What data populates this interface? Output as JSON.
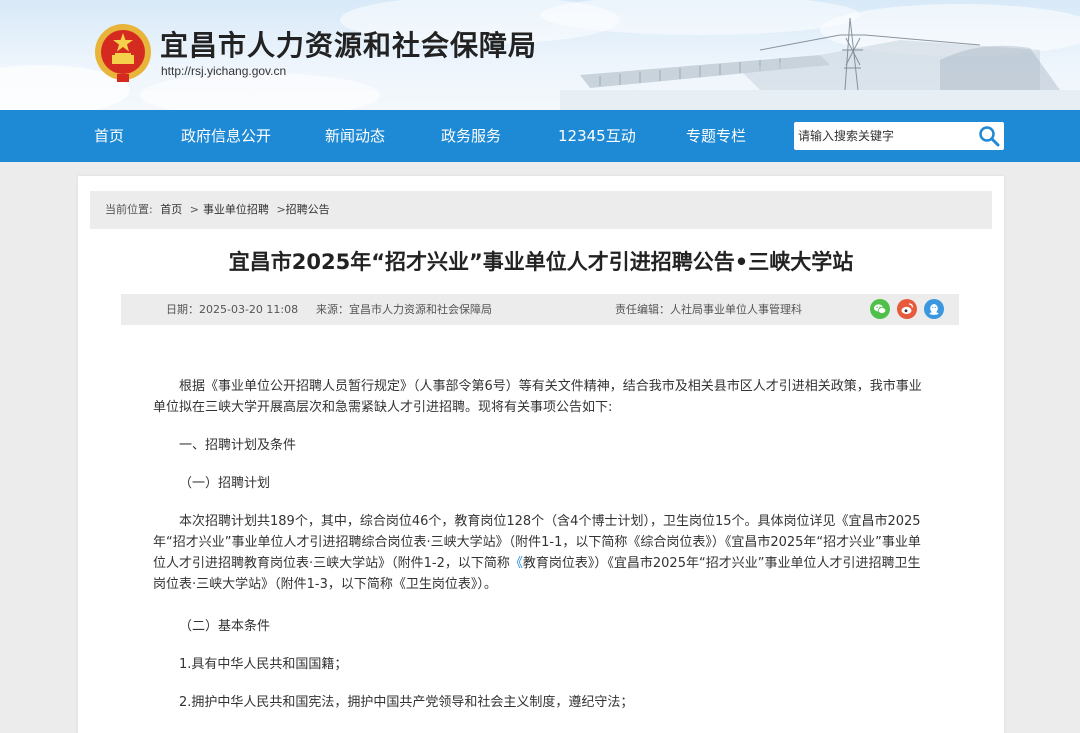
{
  "header": {
    "site_title": "宜昌市人力资源和社会保障局",
    "site_url": "http://rsj.yichang.gov.cn"
  },
  "nav": {
    "items": [
      "首页",
      "政府信息公开",
      "新闻动态",
      "政务服务",
      "12345互动",
      "专题专栏"
    ],
    "search_placeholder": "请输入搜索关键字"
  },
  "breadcrumb": {
    "label": "当前位置:",
    "items": [
      "首页",
      "事业单位招聘",
      "招聘公告"
    ],
    "sep1": ">",
    "sep2": ">"
  },
  "article": {
    "title": "宜昌市2025年“招才兴业”事业单位人才引进招聘公告•三峡大学站",
    "date": "日期：2025-03-20 11:08",
    "source": "来源：宜昌市人力资源和社会保障局",
    "editor": "责任编辑：人社局事业单位人事管理科",
    "paragraphs": {
      "intro": "根据《事业单位公开招聘人员暂行规定》（人事部令第6号）等有关文件精神，结合我市及相关县市区人才引进相关政策，我市事业单位拟在三峡大学开展高层次和急需紧缺人才引进招聘。现将有关事项公告如下:",
      "sec1": "一、招聘计划及条件",
      "sub1": "（一）招聘计划",
      "plan_a": "本次招聘计划共189个，其中，综合岗位46个，教育岗位128个（含4个博士计划），卫生岗位15个。具体岗位详见《宜昌市2025年“招才兴业”事业单位人才引进招聘综合岗位表·三峡大学站》（附件1-1，以下简称《综合岗位表》）《宜昌市2025年“招才兴业”事业单位人才引进招聘教育岗位表·三峡大学站》（附件1-2，以下简称",
      "plan_b": "《",
      "plan_c": "教育岗位表》）《宜昌市2025年“招才兴业”事业单位人才引进招聘卫生岗位表·三峡大学站》（附件1-3，以下简称《卫生岗位表》）。",
      "sub2": "（二）基本条件",
      "cond1": "1.具有中华人民共和国国籍；",
      "cond2": "2.拥护中华人民共和国宪法，拥护中国共产党领导和社会主义制度，遵纪守法；"
    }
  },
  "colors": {
    "nav_bg": "#1e8ad6",
    "page_bg": "#ececec",
    "wechat": "#4fc14b",
    "weibo": "#e85a3c",
    "qq": "#3a97e0"
  }
}
